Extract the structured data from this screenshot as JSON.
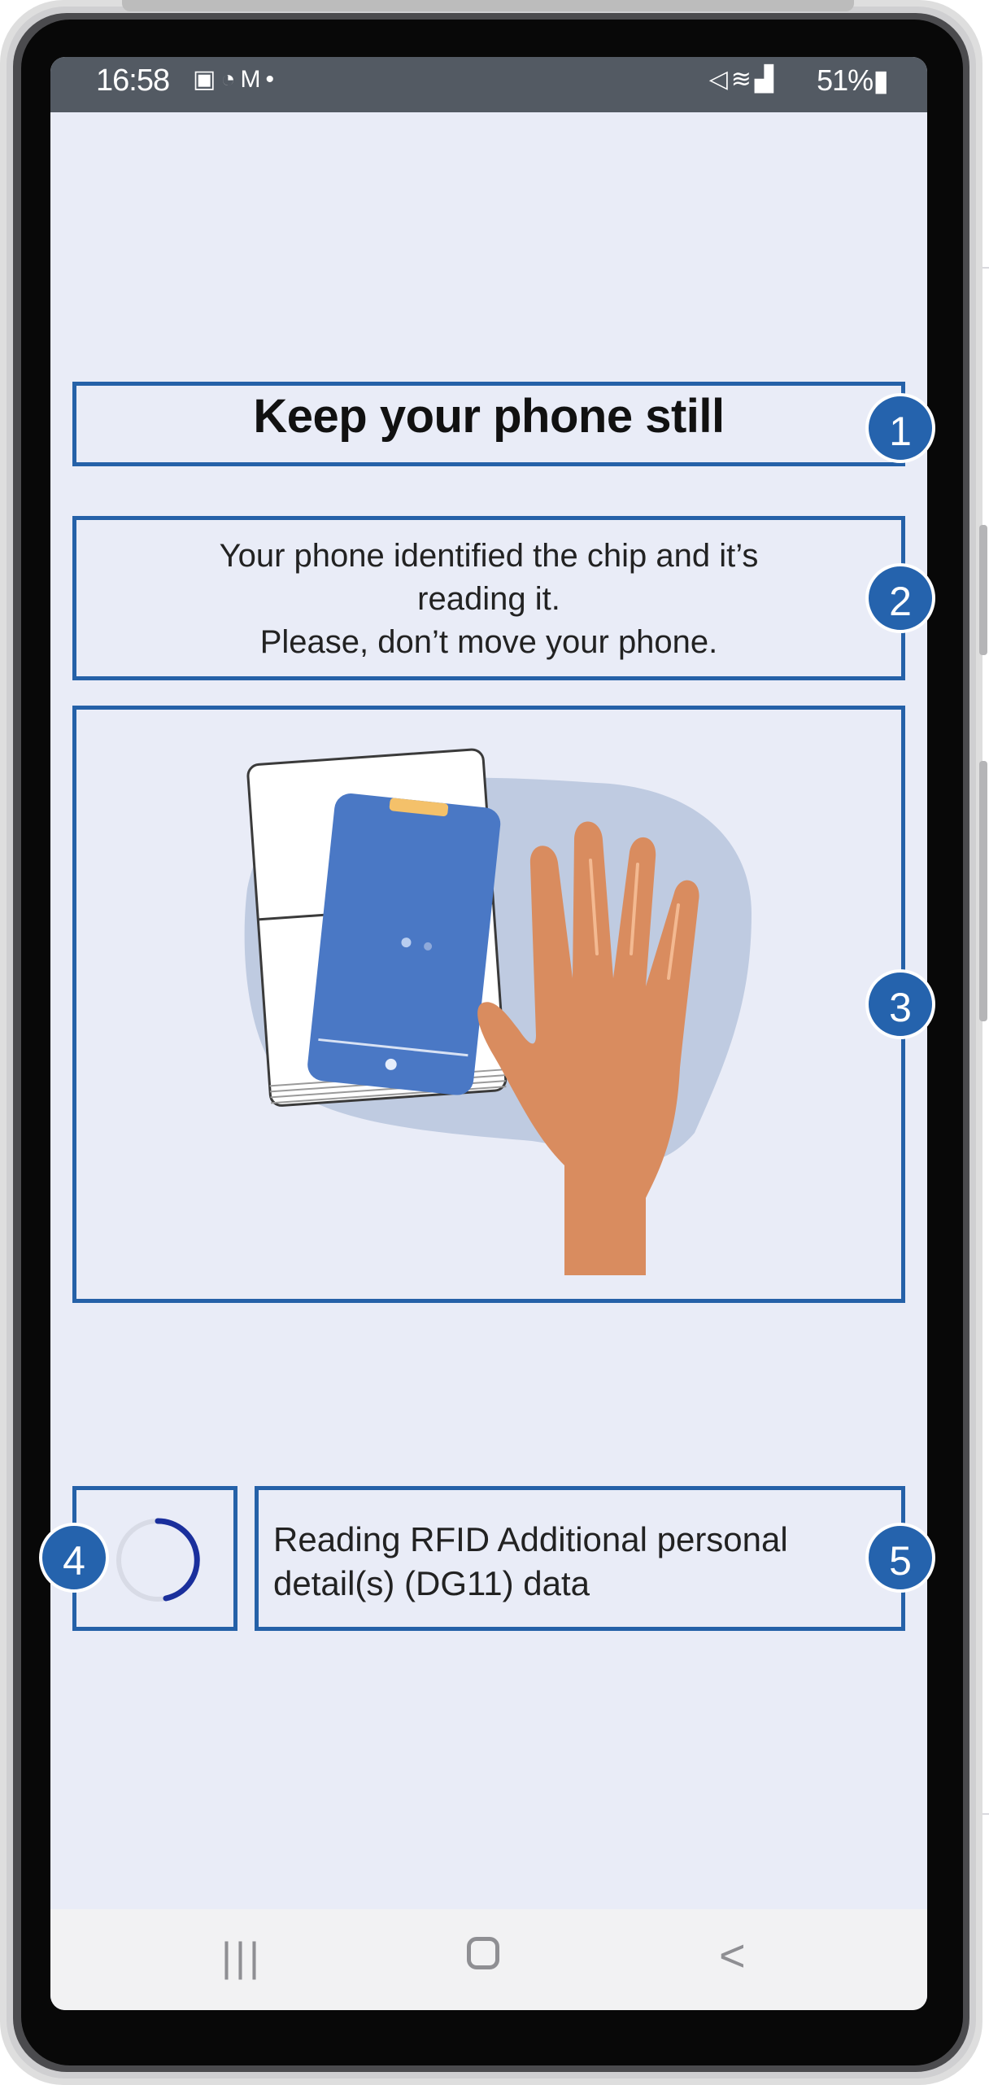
{
  "status_bar": {
    "time": "16:58",
    "left_icons": [
      "sim-icon",
      "messenger-icon",
      "gmail-icon",
      "dot-icon"
    ],
    "right_icons": [
      "mute-icon",
      "wifi-icon",
      "signal-icon"
    ],
    "battery": "51%"
  },
  "screen": {
    "title": "Keep your phone still",
    "message_lines": [
      "Your phone identified the chip and it’s",
      "reading it.",
      "Please, don’t move your phone."
    ],
    "illustration": "phone-on-passport-illustration",
    "reading_status_lines": [
      "Reading RFID Additional personal",
      "detail(s) (DG11) data"
    ]
  },
  "annotations": {
    "badges": [
      "1",
      "2",
      "3",
      "4",
      "5"
    ]
  },
  "nav_bar": {
    "icons": [
      "recent-apps-icon",
      "home-icon",
      "back-icon"
    ]
  },
  "colors": {
    "screen_background": "#e9ecf7",
    "annotation_blue": "#2561a8",
    "illustration_phone": "#4a78c5",
    "hand": "#d98c5f",
    "spinner": "#1a2f9c"
  }
}
